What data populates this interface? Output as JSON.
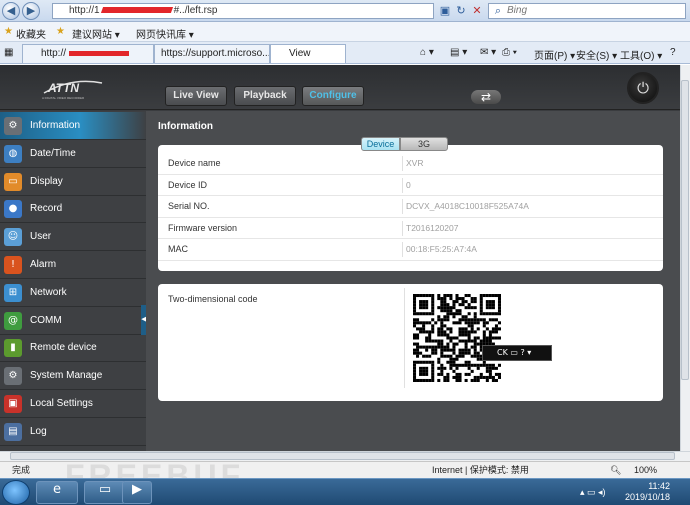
{
  "browser": {
    "url_start": "http://1",
    "url_end": "#../left.rsp",
    "search_placeholder": "Bing",
    "nav_back": "◀",
    "nav_forward": "▶",
    "favorites_label": "收藏夹",
    "fav_links": [
      "建议网站 ▾",
      "网页快讯库 ▾"
    ],
    "tabs": [
      "http://",
      "https://support.microso...",
      "View"
    ],
    "tools": [
      "页面(P) ▾",
      "安全(S) ▾",
      "工具(O) ▾",
      "?"
    ],
    "status_left": "完成",
    "status_zone": "Internet | 保护模式: 禁用",
    "zoom": "100%",
    "watermark": "FREEBUF"
  },
  "app": {
    "logo_text": "ATTN",
    "logo_subtitle": "A DIGITAL VIDEO RECORDER",
    "top_buttons": [
      "Live View",
      "Playback",
      "Configure"
    ],
    "active_top": "Configure",
    "swap_icon": "⇄",
    "power_icon": "⏻",
    "sidebar": [
      {
        "label": "Information",
        "icon": "gear-icon",
        "glyph": "⚙",
        "color": "#6a6f75"
      },
      {
        "label": "Date/Time",
        "icon": "globe-icon",
        "glyph": "◍",
        "color": "#3d7fc2"
      },
      {
        "label": "Display",
        "icon": "display-icon",
        "glyph": "▭",
        "color": "#e28b2a"
      },
      {
        "label": "Record",
        "icon": "record-icon",
        "glyph": "●",
        "color": "#3b78c8"
      },
      {
        "label": "User",
        "icon": "user-icon",
        "glyph": "☺",
        "color": "#5b9fd6"
      },
      {
        "label": "Alarm",
        "icon": "alarm-icon",
        "glyph": "!",
        "color": "#d9531e"
      },
      {
        "label": "Network",
        "icon": "network-icon",
        "glyph": "⊞",
        "color": "#3c8fd0"
      },
      {
        "label": "COMM",
        "icon": "comm-icon",
        "glyph": "@",
        "color": "#3f9c3f"
      },
      {
        "label": "Remote device",
        "icon": "remote-device-icon",
        "glyph": "▮",
        "color": "#5c9b2e"
      },
      {
        "label": "System Manage",
        "icon": "system-gear-icon",
        "glyph": "⚙",
        "color": "#6a6f75"
      },
      {
        "label": "Local Settings",
        "icon": "local-settings-icon",
        "glyph": "▣",
        "color": "#c8322a"
      },
      {
        "label": "Log",
        "icon": "log-icon",
        "glyph": "▤",
        "color": "#4c6fa0"
      }
    ],
    "active_sidebar": "Information",
    "section_title": "Information",
    "subtabs": [
      "Device",
      "3G"
    ],
    "info_rows": [
      {
        "label": "Device name",
        "value": "XVR"
      },
      {
        "label": "Device ID",
        "value": "0"
      },
      {
        "label": "Serial NO.",
        "value": "DCVX_A4018C10018F525A74A"
      },
      {
        "label": "Firmware version",
        "value": "T2016120207"
      },
      {
        "label": "MAC",
        "value": "00:18:F5:25:A7:4A"
      }
    ],
    "qr_label": "Two-dimensional code",
    "popup_text": "CK ▭ ? ▾"
  },
  "taskbar": {
    "time": "11:42",
    "date": "2019/10/18"
  }
}
